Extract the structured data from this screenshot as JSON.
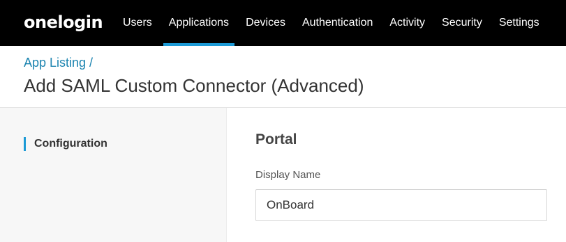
{
  "brand": {
    "logo_text": "onelogin"
  },
  "nav": {
    "items": [
      {
        "label": "Users",
        "active": false
      },
      {
        "label": "Applications",
        "active": true
      },
      {
        "label": "Devices",
        "active": false
      },
      {
        "label": "Authentication",
        "active": false
      },
      {
        "label": "Activity",
        "active": false
      },
      {
        "label": "Security",
        "active": false
      },
      {
        "label": "Settings",
        "active": false
      }
    ]
  },
  "header": {
    "breadcrumb": "App Listing /",
    "title": "Add SAML Custom Connector (Advanced)"
  },
  "sidebar": {
    "items": [
      {
        "label": "Configuration",
        "active": true
      }
    ]
  },
  "main": {
    "section_title": "Portal",
    "display_name": {
      "label": "Display Name",
      "value": "OnBoard"
    }
  },
  "colors": {
    "topbar_bg": "#000000",
    "accent": "#1c9ad6",
    "link": "#1c84b0"
  }
}
